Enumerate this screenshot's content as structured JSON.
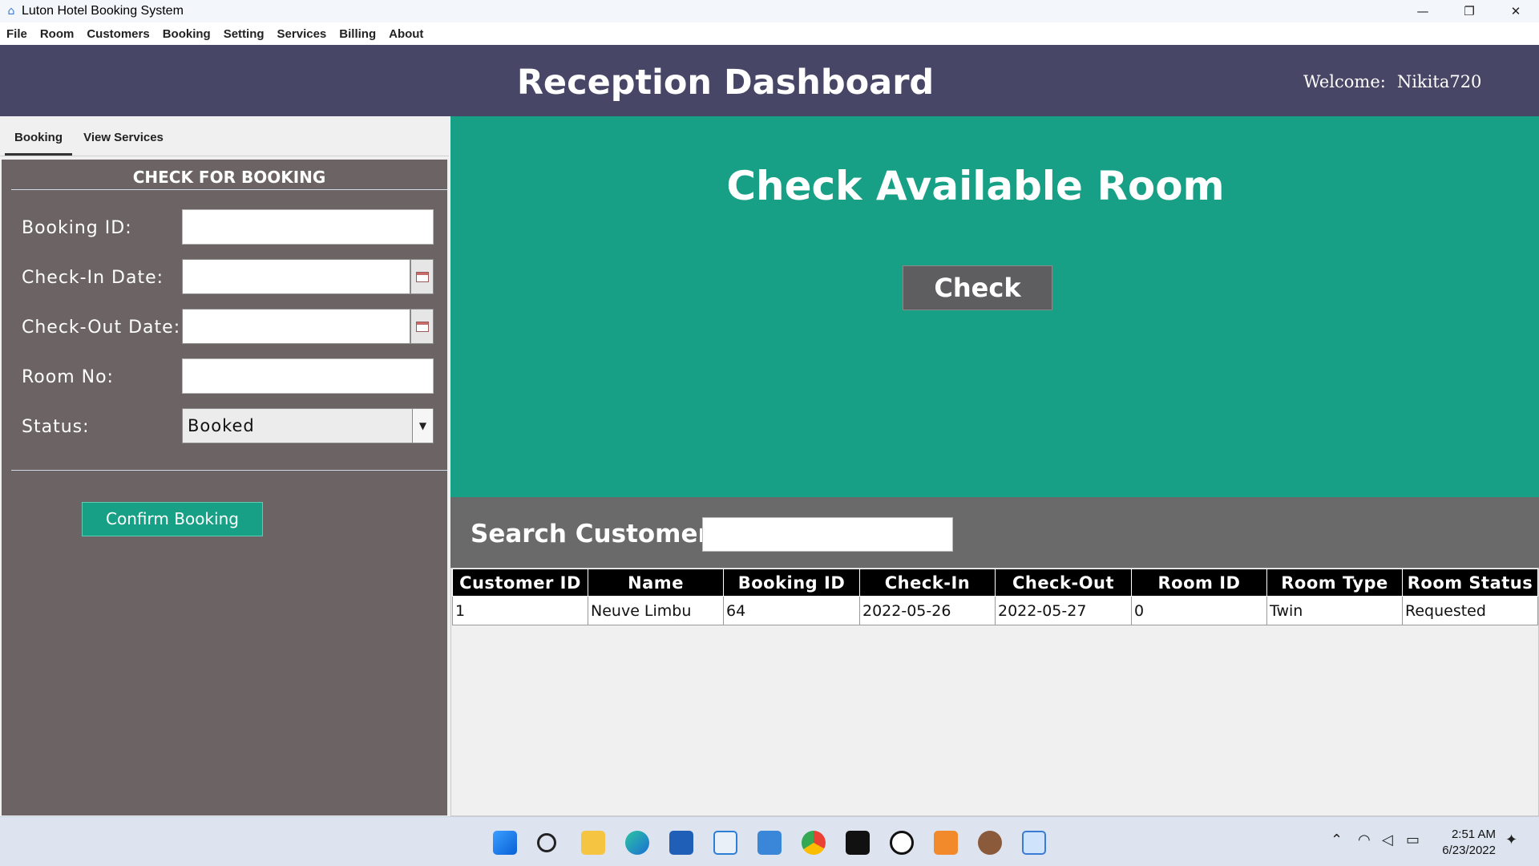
{
  "window": {
    "title": "Luton Hotel Booking System",
    "controls": {
      "minimize": "—",
      "maximize": "❐",
      "close": "✕"
    }
  },
  "menu": [
    "File",
    "Room",
    "Customers",
    "Booking",
    "Setting",
    "Services",
    "Billing",
    "About"
  ],
  "header": {
    "title": "Reception Dashboard",
    "welcome_label": "Welcome:",
    "username": "Nikita720"
  },
  "tabs": [
    {
      "label": "Booking",
      "active": true
    },
    {
      "label": "View Services",
      "active": false
    }
  ],
  "booking_form": {
    "heading": "CHECK FOR BOOKING",
    "booking_id_label": "Booking ID:",
    "booking_id_value": "",
    "checkin_label": "Check-In Date:",
    "checkin_value": "",
    "checkout_label": "Check-Out Date:",
    "checkout_value": "",
    "room_no_label": "Room No:",
    "room_no_value": "",
    "status_label": "Status:",
    "status_value": "Booked",
    "confirm_label": "Confirm Booking"
  },
  "availability": {
    "title": "Check Available Room",
    "check_label": "Check"
  },
  "search": {
    "label": "Search Customer:",
    "value": ""
  },
  "table": {
    "columns": [
      "Customer ID",
      "Name",
      "Booking ID",
      "Check-In",
      "Check-Out",
      "Room ID",
      "Room Type",
      "Room Status"
    ],
    "rows": [
      [
        "1",
        "Neuve Limbu",
        "64",
        "2022-05-26",
        "2022-05-27",
        "0",
        "Twin",
        "Requested"
      ]
    ]
  },
  "taskbar": {
    "time": "2:51 AM",
    "date": "6/23/2022",
    "icons": [
      "windows-start-icon",
      "search-icon",
      "file-explorer-icon",
      "edge-icon",
      "store-icon",
      "snipping-tool-icon",
      "notepad-icon",
      "chrome-icon",
      "netflix-icon",
      "eclipse-icon",
      "xampp-icon",
      "app-icon",
      "hotel-app-icon"
    ]
  },
  "colors": {
    "header_bg": "#474666",
    "accent_green": "#17a085",
    "panel_gray": "#6c6464"
  }
}
